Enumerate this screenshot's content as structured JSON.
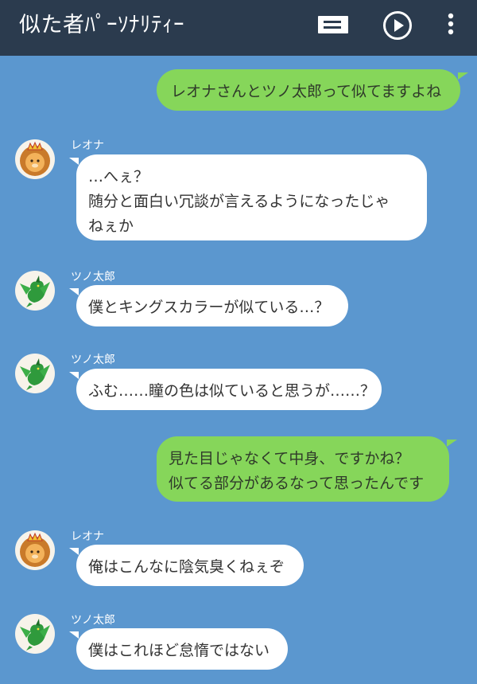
{
  "app": {
    "title": "似た者ﾊﾟｰｿﾅﾘﾃｨｰ",
    "icons": {
      "message": "message-icon",
      "play": "play-icon",
      "more": "more-vertical-icon"
    }
  },
  "colors": {
    "header": "#2b3b4e",
    "background": "#5b97cf",
    "outgoing_bubble": "#86d65a",
    "incoming_bubble": "#ffffff"
  },
  "messages": [
    {
      "side": "out",
      "lines": [
        "レオナさんとツノ太郎って似てますよね"
      ]
    },
    {
      "side": "in",
      "sender": "レオナ",
      "avatar": "lion-avatar",
      "lines": [
        "…へぇ？",
        "随分と面白い冗談が言えるようになったじゃ",
        "ねぇか"
      ]
    },
    {
      "side": "in",
      "sender": "ツノ太郎",
      "avatar": "dragon-avatar",
      "lines": [
        "僕とキングスカラーが似ている…？"
      ]
    },
    {
      "side": "in",
      "sender": "ツノ太郎",
      "avatar": "dragon-avatar",
      "lines": [
        "ふむ……瞳の色は似ていると思うが……？"
      ]
    },
    {
      "side": "out",
      "lines": [
        "見た目じゃなくて中身、ですかね？",
        "似てる部分があるなって思ったんです"
      ]
    },
    {
      "side": "in",
      "sender": "レオナ",
      "avatar": "lion-avatar",
      "lines": [
        "俺はこんなに陰気臭くねぇぞ"
      ]
    },
    {
      "side": "in",
      "sender": "ツノ太郎",
      "avatar": "dragon-avatar",
      "lines": [
        "僕はこれほど怠惰ではない"
      ]
    }
  ]
}
